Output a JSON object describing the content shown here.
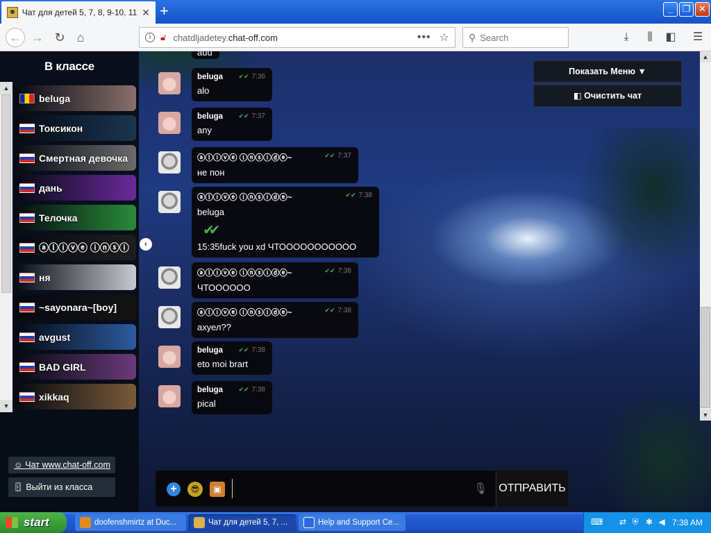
{
  "browser": {
    "tab_title": "Чат для детей 5, 7, 8, 9-10, 11,",
    "url_host": "chatdljadetey.",
    "url_domain": "chat-off.com",
    "search_placeholder": "Search"
  },
  "sidebar": {
    "title": "В классе",
    "users": [
      {
        "name": "beluga",
        "flag": "ro",
        "bg": "#8a6f6a"
      },
      {
        "name": "Токсикон",
        "flag": "ru",
        "bg": "#1a3550"
      },
      {
        "name": "Смертная девочка",
        "flag": "ru",
        "bg": "#6b6b6b"
      },
      {
        "name": "дань",
        "flag": "ru",
        "bg": "#6a2a9a"
      },
      {
        "name": "Телочка",
        "flag": "ru",
        "bg": "#2a8a3a"
      },
      {
        "name": "ⓐⓛⓘⓥⓔ ⓘⓝⓢⓘ",
        "flag": "ru",
        "bg": "#1e1e1e"
      },
      {
        "name": "ня",
        "flag": "ru",
        "bg": "#c8c8d0"
      },
      {
        "name": "~sayonara~[boy]",
        "flag": "ru",
        "bg": "#141414"
      },
      {
        "name": "avgust",
        "flag": "ru",
        "bg": "#2d5aa0"
      },
      {
        "name": "BAD GIRL",
        "flag": "ru",
        "bg": "#6a3a7a"
      },
      {
        "name": "xikkaq",
        "flag": "ru",
        "bg": "#7a5a3a"
      }
    ],
    "site_link": "Чат www.chat-off.com",
    "leave_class": "Выйти из класса"
  },
  "menu": {
    "show_menu": "Показать Меню ▼",
    "clear_chat": "Очистить чат"
  },
  "messages": [
    {
      "author": "beluga",
      "time": "7:36",
      "text": "alo",
      "avatar": "beluga"
    },
    {
      "author": "beluga",
      "time": "7:37",
      "text": "any",
      "avatar": "beluga"
    },
    {
      "author": "ⓐⓛⓘⓥⓔ ⓘⓝⓢⓘⓓⓔ~",
      "time": "7:37",
      "text": "не пон",
      "avatar": "alive"
    },
    {
      "author": "ⓐⓛⓘⓥⓔ ⓘⓝⓢⓘⓓⓔ~",
      "time": "7:38",
      "text": "beluga",
      "text2": "15:35fuck you xd ЧТООООООООООО",
      "avatar": "alive"
    },
    {
      "author": "ⓐⓛⓘⓥⓔ ⓘⓝⓢⓘⓓⓔ~",
      "time": "7:38",
      "text": "ЧТОООООО",
      "avatar": "alive"
    },
    {
      "author": "ⓐⓛⓘⓥⓔ ⓘⓝⓢⓘⓓⓔ~",
      "time": "7:38",
      "text": "ахуел??",
      "avatar": "alive"
    },
    {
      "author": "beluga",
      "time": "7:38",
      "text": "eto moi brart",
      "avatar": "beluga"
    },
    {
      "author": "beluga",
      "time": "7:38",
      "text": "pical",
      "avatar": "beluga"
    }
  ],
  "partial_top_text": "auu",
  "composer": {
    "send_label": "ОТПРАВИТЬ"
  },
  "taskbar": {
    "start_label": "start",
    "tasks": [
      "doofenshmirtz at Duc...",
      "Чат для детей 5, 7, ...",
      "Help and Support Ce..."
    ],
    "clock": "7:38 AM"
  }
}
